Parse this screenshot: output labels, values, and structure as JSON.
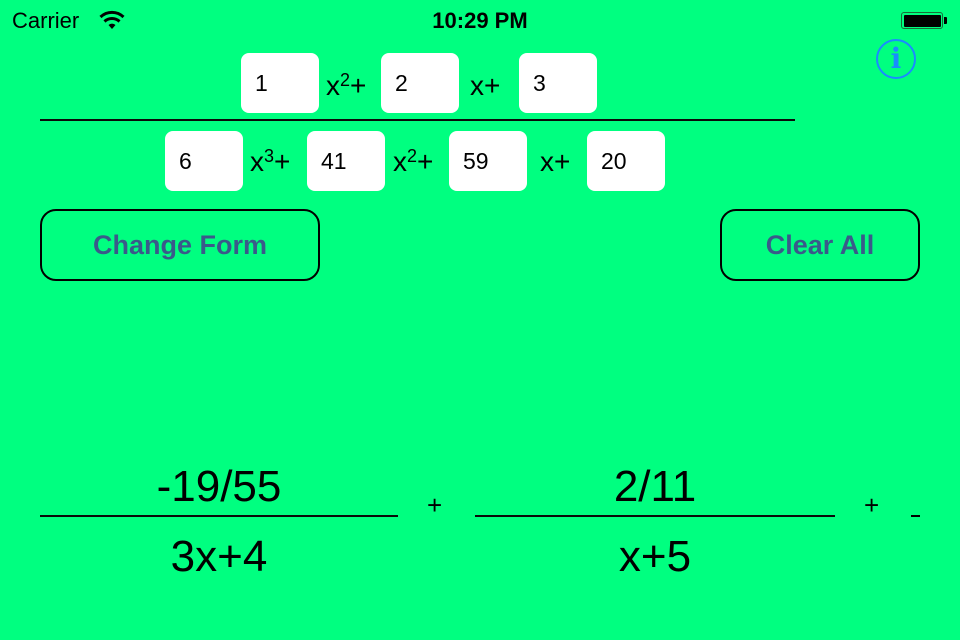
{
  "status_bar": {
    "carrier": "Carrier",
    "time": "10:29 PM",
    "wifi_icon": "wifi-icon",
    "battery_icon": "battery-full-icon"
  },
  "info_button": {
    "icon": "info-icon",
    "glyph": "i",
    "color": "#1a8cff"
  },
  "numerator": {
    "coefficients": [
      "1",
      "2",
      "3"
    ],
    "terms": [
      "x²+",
      "x+"
    ]
  },
  "denominator": {
    "coefficients": [
      "6",
      "41",
      "59",
      "20"
    ],
    "terms": [
      "x³+",
      "x²+",
      "x+"
    ]
  },
  "buttons": {
    "change_form": "Change Form",
    "clear_all": "Clear All",
    "text_color": "#3a5a8a"
  },
  "result": {
    "fractions": [
      {
        "numerator": "-19/55",
        "denominator": "3x+4"
      },
      {
        "numerator": "2/11",
        "denominator": "x+5"
      }
    ],
    "operators": [
      "+",
      "+",
      "-"
    ]
  },
  "colors": {
    "background": "#00ff80"
  }
}
